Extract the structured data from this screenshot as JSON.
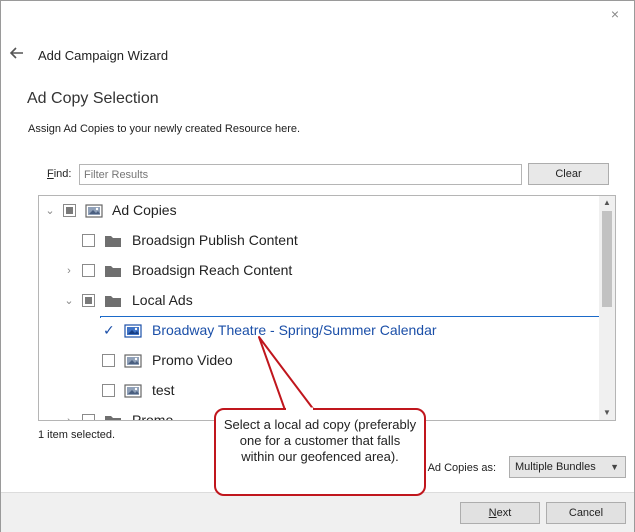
{
  "window": {
    "close_glyph": "×"
  },
  "header": {
    "title": "Add Campaign Wizard"
  },
  "section": {
    "title": "Ad Copy Selection",
    "description": "Assign Ad Copies to your newly created Resource here."
  },
  "find": {
    "label_prefix": "F",
    "label_rest": "ind:",
    "placeholder": "Filter Results",
    "value": ""
  },
  "clear_button": {
    "label": "Clear"
  },
  "tree": {
    "items": [
      {
        "label": "Ad Copies",
        "icon": "image-icon",
        "state": "partial",
        "expander": "collapse"
      },
      {
        "label": "Broadsign Publish Content",
        "icon": "folder-icon",
        "state": "unchecked",
        "expander": "none"
      },
      {
        "label": "Broadsign Reach Content",
        "icon": "folder-icon",
        "state": "unchecked",
        "expander": "expand"
      },
      {
        "label": "Local Ads",
        "icon": "folder-icon",
        "state": "partial",
        "expander": "collapse"
      },
      {
        "label": "Broadway Theatre - Spring/Summer Calendar",
        "icon": "image-icon",
        "state": "checked",
        "expander": "none"
      },
      {
        "label": "Promo Video",
        "icon": "image-icon",
        "state": "unchecked",
        "expander": "none"
      },
      {
        "label": "test",
        "icon": "image-icon",
        "state": "unchecked",
        "expander": "none"
      },
      {
        "label": "Promo",
        "icon": "folder-icon",
        "state": "unchecked",
        "expander": "expand"
      }
    ],
    "selected_color": "#1b4fa8"
  },
  "status": {
    "text": "1 item selected."
  },
  "bundles": {
    "label": "e Ad Copies as:",
    "selected": "Multiple Bundles"
  },
  "footer": {
    "next_prefix": "N",
    "next_rest": "ext",
    "cancel_label": "Cancel"
  },
  "callout": {
    "text": "Select a local ad copy (preferably one for a customer that falls within our geofenced area).",
    "border_color": "#c0161d"
  }
}
